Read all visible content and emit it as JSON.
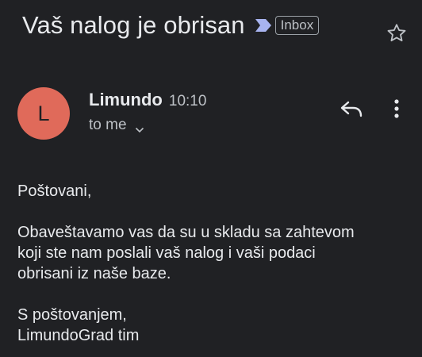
{
  "email": {
    "subject": "Vaš nalog je obrisan",
    "label": "Inbox",
    "sender": {
      "name": "Limundo",
      "time": "10:10",
      "avatar_letter": "L",
      "avatar_color": "#e06a5a"
    },
    "recipient": "to me",
    "body": {
      "greeting": "Poštovani,",
      "paragraph_lines": [
        "Obaveštavamo vas da su u skladu sa zahtevom",
        "koji ste nam poslali vaš nalog i vaši podaci",
        "obrisani iz naše baze."
      ],
      "closing": "S poštovanjem,",
      "signature": "LimundoGrad tim"
    }
  },
  "icons": {
    "importance": "importance-marker-icon",
    "star": "star-outline-icon",
    "reply": "reply-arrow-icon",
    "more": "more-vert-icon",
    "expand": "chevron-down-icon"
  },
  "colors": {
    "background": "#202124",
    "text_primary": "#e8eaed",
    "text_secondary": "#bdc1c6",
    "importance_marker": "#a8b4f0"
  }
}
